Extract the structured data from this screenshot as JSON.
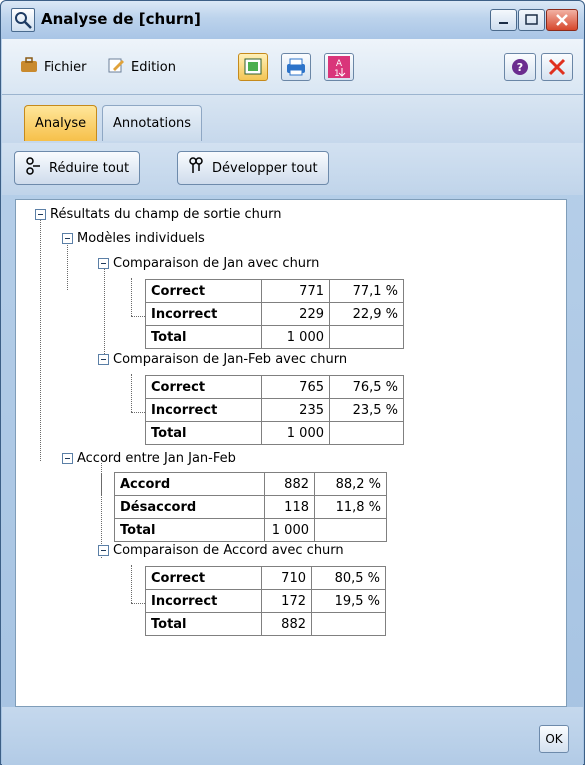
{
  "window": {
    "title": "Analyse de [churn]"
  },
  "toolbar": {
    "file_label": "Fichier",
    "edit_label": "Edition"
  },
  "tabs": [
    {
      "label": "Analyse"
    },
    {
      "label": "Annotations"
    }
  ],
  "actions": {
    "collapse_label": "Réduire tout",
    "expand_label": "Développer tout"
  },
  "tree": {
    "root": "Résultats du champ de sortie churn",
    "models": "Modèles individuels",
    "cmp1": "Comparaison de Jan avec churn",
    "cmp2": "Comparaison de Jan-Feb avec churn",
    "agreement": "Accord entre  Jan Jan-Feb",
    "cmp3": "Comparaison de Accord avec churn"
  },
  "tables": {
    "t1": [
      {
        "label": "Correct",
        "count": "771",
        "pct": "77,1 %"
      },
      {
        "label": "Incorrect",
        "count": "229",
        "pct": "22,9 %"
      },
      {
        "label": "Total",
        "count": "1 000",
        "pct": ""
      }
    ],
    "t2": [
      {
        "label": "Correct",
        "count": "765",
        "pct": "76,5 %"
      },
      {
        "label": "Incorrect",
        "count": "235",
        "pct": "23,5 %"
      },
      {
        "label": "Total",
        "count": "1 000",
        "pct": ""
      }
    ],
    "t3": [
      {
        "label": "Accord",
        "count": "882",
        "pct": "88,2 %"
      },
      {
        "label": "Désaccord",
        "count": "118",
        "pct": "11,8 %"
      },
      {
        "label": "Total",
        "count": "1 000",
        "pct": ""
      }
    ],
    "t4": [
      {
        "label": "Correct",
        "count": "710",
        "pct": "80,5 %"
      },
      {
        "label": "Incorrect",
        "count": "172",
        "pct": "19,5 %"
      },
      {
        "label": "Total",
        "count": "882",
        "pct": ""
      }
    ]
  },
  "footer": {
    "ok_label": "OK"
  }
}
